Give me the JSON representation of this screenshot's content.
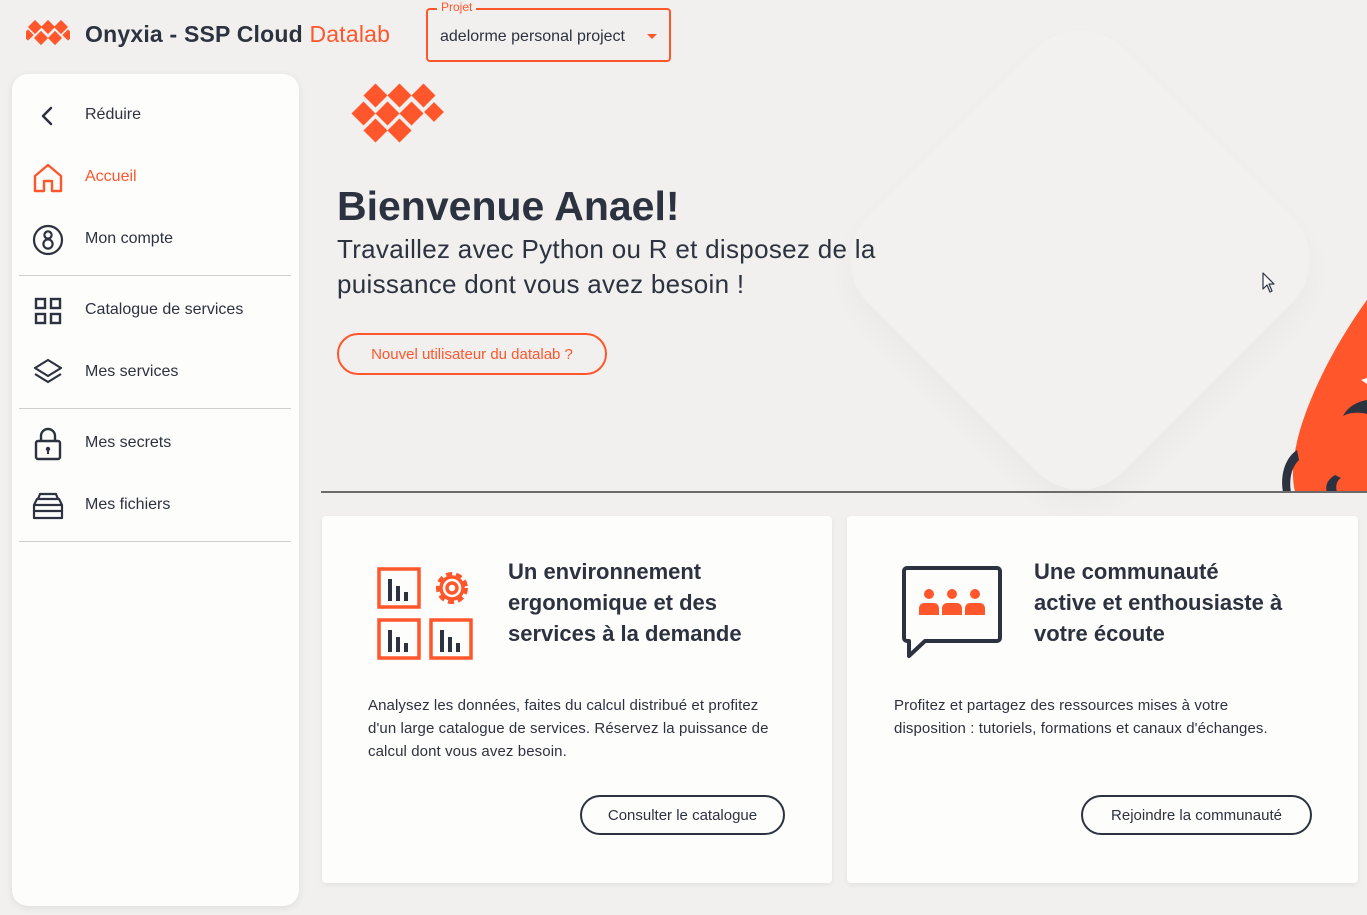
{
  "header": {
    "app_name": "Onyxia - SSP Cloud",
    "app_accent": "Datalab",
    "project_label": "Projet",
    "project_value": "adelorme personal project"
  },
  "sidebar": {
    "items": [
      {
        "label": "Réduire",
        "icon": "chevron-left-icon"
      },
      {
        "label": "Accueil",
        "icon": "home-icon",
        "active": true
      },
      {
        "label": "Mon compte",
        "icon": "account-icon"
      },
      {
        "label": "Catalogue de services",
        "icon": "grid-icon"
      },
      {
        "label": "Mes services",
        "icon": "layers-icon"
      },
      {
        "label": "Mes secrets",
        "icon": "lock-icon"
      },
      {
        "label": "Mes fichiers",
        "icon": "files-icon"
      }
    ]
  },
  "hero": {
    "title": "Bienvenue Anael!",
    "subtitle": "Travaillez avec Python ou R et disposez de la puissance dont vous avez besoin !",
    "button": "Nouvel utilisateur du datalab ?"
  },
  "cards": [
    {
      "title": "Un environnement ergonomique et des services à la demande",
      "description": "Analysez les données, faites du calcul distribué et profitez d'un large catalogue de services. Réservez la puissance de calcul dont vous avez besoin.",
      "button": "Consulter le catalogue"
    },
    {
      "title": "Une communauté active et enthousiaste à votre écoute",
      "description": "Profitez et partagez des ressources mises à votre disposition : tutoriels, formations et canaux d'échanges.",
      "button": "Rejoindre la communauté"
    }
  ],
  "colors": {
    "accent": "#ff562c",
    "text": "#2c323f",
    "background": "#f1f0ee"
  }
}
